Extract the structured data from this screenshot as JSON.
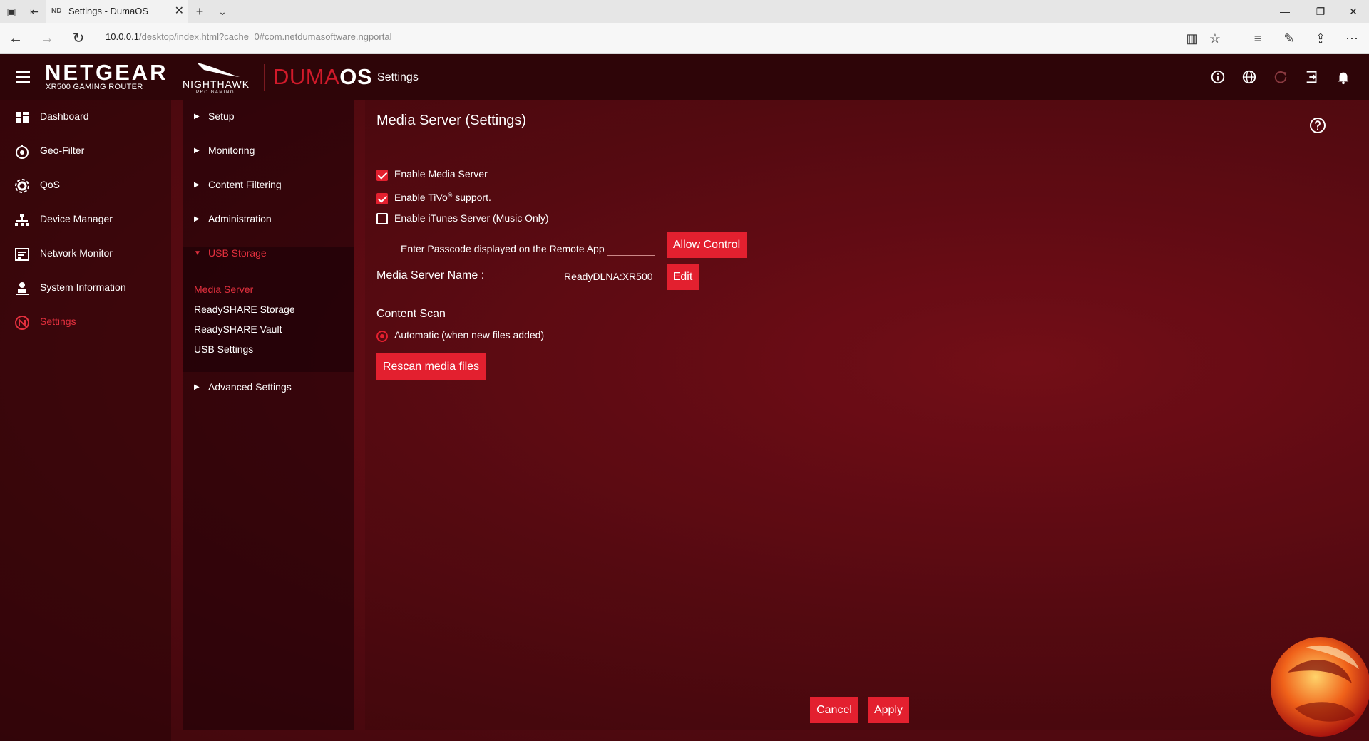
{
  "browser": {
    "tab_title": "Settings - DumaOS",
    "tab_favicon": "ND",
    "url_host": "10.0.0.1",
    "url_path": "/desktop/index.html?cache=0#com.netdumasoftware.ngportal"
  },
  "header": {
    "brand": "NETGEAR",
    "model": "XR500 GAMING ROUTER",
    "nighthawk": "NIGHTHAWK",
    "nighthawk_sub": "PRO GAMING",
    "duma": "DUMA",
    "os": "OS",
    "section": "Settings"
  },
  "sidebar": {
    "items": [
      {
        "label": "Dashboard",
        "icon": "dashboard-icon"
      },
      {
        "label": "Geo-Filter",
        "icon": "geo-filter-icon"
      },
      {
        "label": "QoS",
        "icon": "qos-icon"
      },
      {
        "label": "Device Manager",
        "icon": "device-manager-icon"
      },
      {
        "label": "Network Monitor",
        "icon": "network-monitor-icon"
      },
      {
        "label": "System Information",
        "icon": "system-information-icon"
      },
      {
        "label": "Settings",
        "icon": "settings-icon",
        "active": true
      }
    ]
  },
  "subnav": {
    "setup": "Setup",
    "monitoring": "Monitoring",
    "content_filtering": "Content Filtering",
    "administration": "Administration",
    "usb_storage": "USB Storage",
    "children": [
      "Media Server",
      "ReadySHARE Storage",
      "ReadySHARE Vault",
      "USB Settings"
    ],
    "advanced": "Advanced Settings"
  },
  "main": {
    "title": "Media Server (Settings)",
    "enable_media_server": "Enable Media Server",
    "enable_tivo_a": "Enable TiVo",
    "enable_tivo_sup": "®",
    "enable_tivo_b": " support.",
    "enable_itunes": "Enable iTunes Server (Music Only)",
    "passcode_label": "Enter Passcode displayed on the Remote App",
    "allow_control": "Allow Control",
    "media_server_name_label": "Media Server Name :",
    "media_server_name_value": "ReadyDLNA:XR500",
    "edit": "Edit",
    "content_scan": "Content Scan",
    "automatic": "Automatic (when new files added)",
    "rescan": "Rescan media files",
    "cancel": "Cancel",
    "apply": "Apply"
  },
  "colors": {
    "accent": "#e3202f",
    "header": "#2e0508"
  }
}
